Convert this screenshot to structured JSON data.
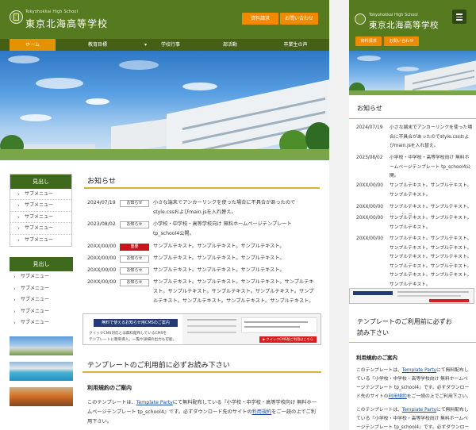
{
  "site": {
    "subtitle": "Tokyohokkai High School",
    "title": "東京北海高等学校",
    "btn_request": "資料請求",
    "btn_contact": "お問い合わせ"
  },
  "nav": [
    {
      "label": "ホーム",
      "active": true
    },
    {
      "label": "教育目標",
      "active": false
    },
    {
      "label": "学校行事",
      "active": false
    },
    {
      "label": "部活動",
      "active": false
    },
    {
      "label": "卒業生の声",
      "active": false
    }
  ],
  "sidebar": {
    "box1": {
      "heading": "見出し",
      "items": [
        "サブメニュー",
        "サブメニュー",
        "サブメニュー",
        "サブメニュー",
        "サブメニュー"
      ]
    },
    "box2": {
      "heading": "見出し",
      "items": [
        "サブメニュー",
        "サブメニュー",
        "サブメニュー",
        "サブメニュー",
        "サブメニュー"
      ]
    }
  },
  "news": {
    "heading": "お知らせ",
    "items": [
      {
        "date": "2024/07/19",
        "category": "お知らせ",
        "text": "小さな端末でアンカーリンクを使った場合に不具合があったのでstyle.cssおよびmain.jsを入れ替え。"
      },
      {
        "date": "2023/08/02",
        "category": "お知らせ",
        "text": "小学校・中学校・高等学校向け 無料ホームページテンプレート tp_school4公開。"
      },
      {
        "date": "20XX/00/00",
        "category": "重要",
        "text": "サンプルテキスト。サンプルテキスト。サンプルテキスト。"
      },
      {
        "date": "20XX/00/00",
        "category": "お知らせ",
        "text": "サンプルテキスト。サンプルテキスト。サンプルテキスト。"
      },
      {
        "date": "20XX/00/00",
        "category": "お知らせ",
        "text": "サンプルテキスト。サンプルテキスト。サンプルテキスト。"
      },
      {
        "date": "20XX/00/00",
        "category": "お知らせ",
        "text": "サンプルテキスト。サンプルテキスト。サンプルテキスト。サンプルテキスト。サンプルテキスト。サンプルテキスト。サンプルテキスト。サンプルテキスト。サンプルテキスト。サンプルテキスト。サンプルテキスト。"
      }
    ]
  },
  "banner": {
    "tag": "無料で使えるお知らせ用CMSのご案内",
    "line1": "クイックCMS対応とは無料配布しているCMSを",
    "line2": "テンプレートに簡単導入。一覧や詳細の出力も可能。",
    "cta": "▶ クイックCMS版ご利用はこちら"
  },
  "template_notice": {
    "heading": "テンプレートのご利用前に必ずお読み下さい",
    "subheading": "利用規約のご案内",
    "para_a": "このテンプレートは、",
    "link_tp": "Template Party",
    "para_b": "にて無料配布している『小学校・中学校・高等学校向け 無料ホームページテンプレート tp_school4』です。必ずダウンロード先のサイトの",
    "link_terms": "利用規約",
    "para_c": "をご一読の上でご利用下さい。"
  },
  "mobile": {
    "news_heading": "お知らせ",
    "template_heading_1": "テンプレートのご利用前に必ずお",
    "template_heading_2": "読み下さい",
    "subheading": "利用規約のご案内",
    "para1_a": "このテンプレートは、",
    "para1_link": "Template Party",
    "para1_b": "にて無料配布している『小学校・中学校・高等学校向け 無料ホームページテンプレート tp_school4』です。必ずダウンロード先のサイトの",
    "para1_link2": "利用規約",
    "para1_c": "をご一読の上でご利用下さい。",
    "para2_a": "このテンプレートは、",
    "para2_link": "Template Party",
    "para2_b": "にて無料配布している『小学校・中学校・高等学校向け 無料ホームページテンプレート tp_school4』です。必ずダウンロード先のサイトの利用規約をご一読の上でご利用下さい。"
  },
  "colors": {
    "header_green": "#557a1f",
    "nav_green": "#455f14",
    "accent_orange": "#f08a00",
    "active_orange": "#e39300",
    "important_red": "#c8161d",
    "gold_rule": "#d8b33c"
  }
}
